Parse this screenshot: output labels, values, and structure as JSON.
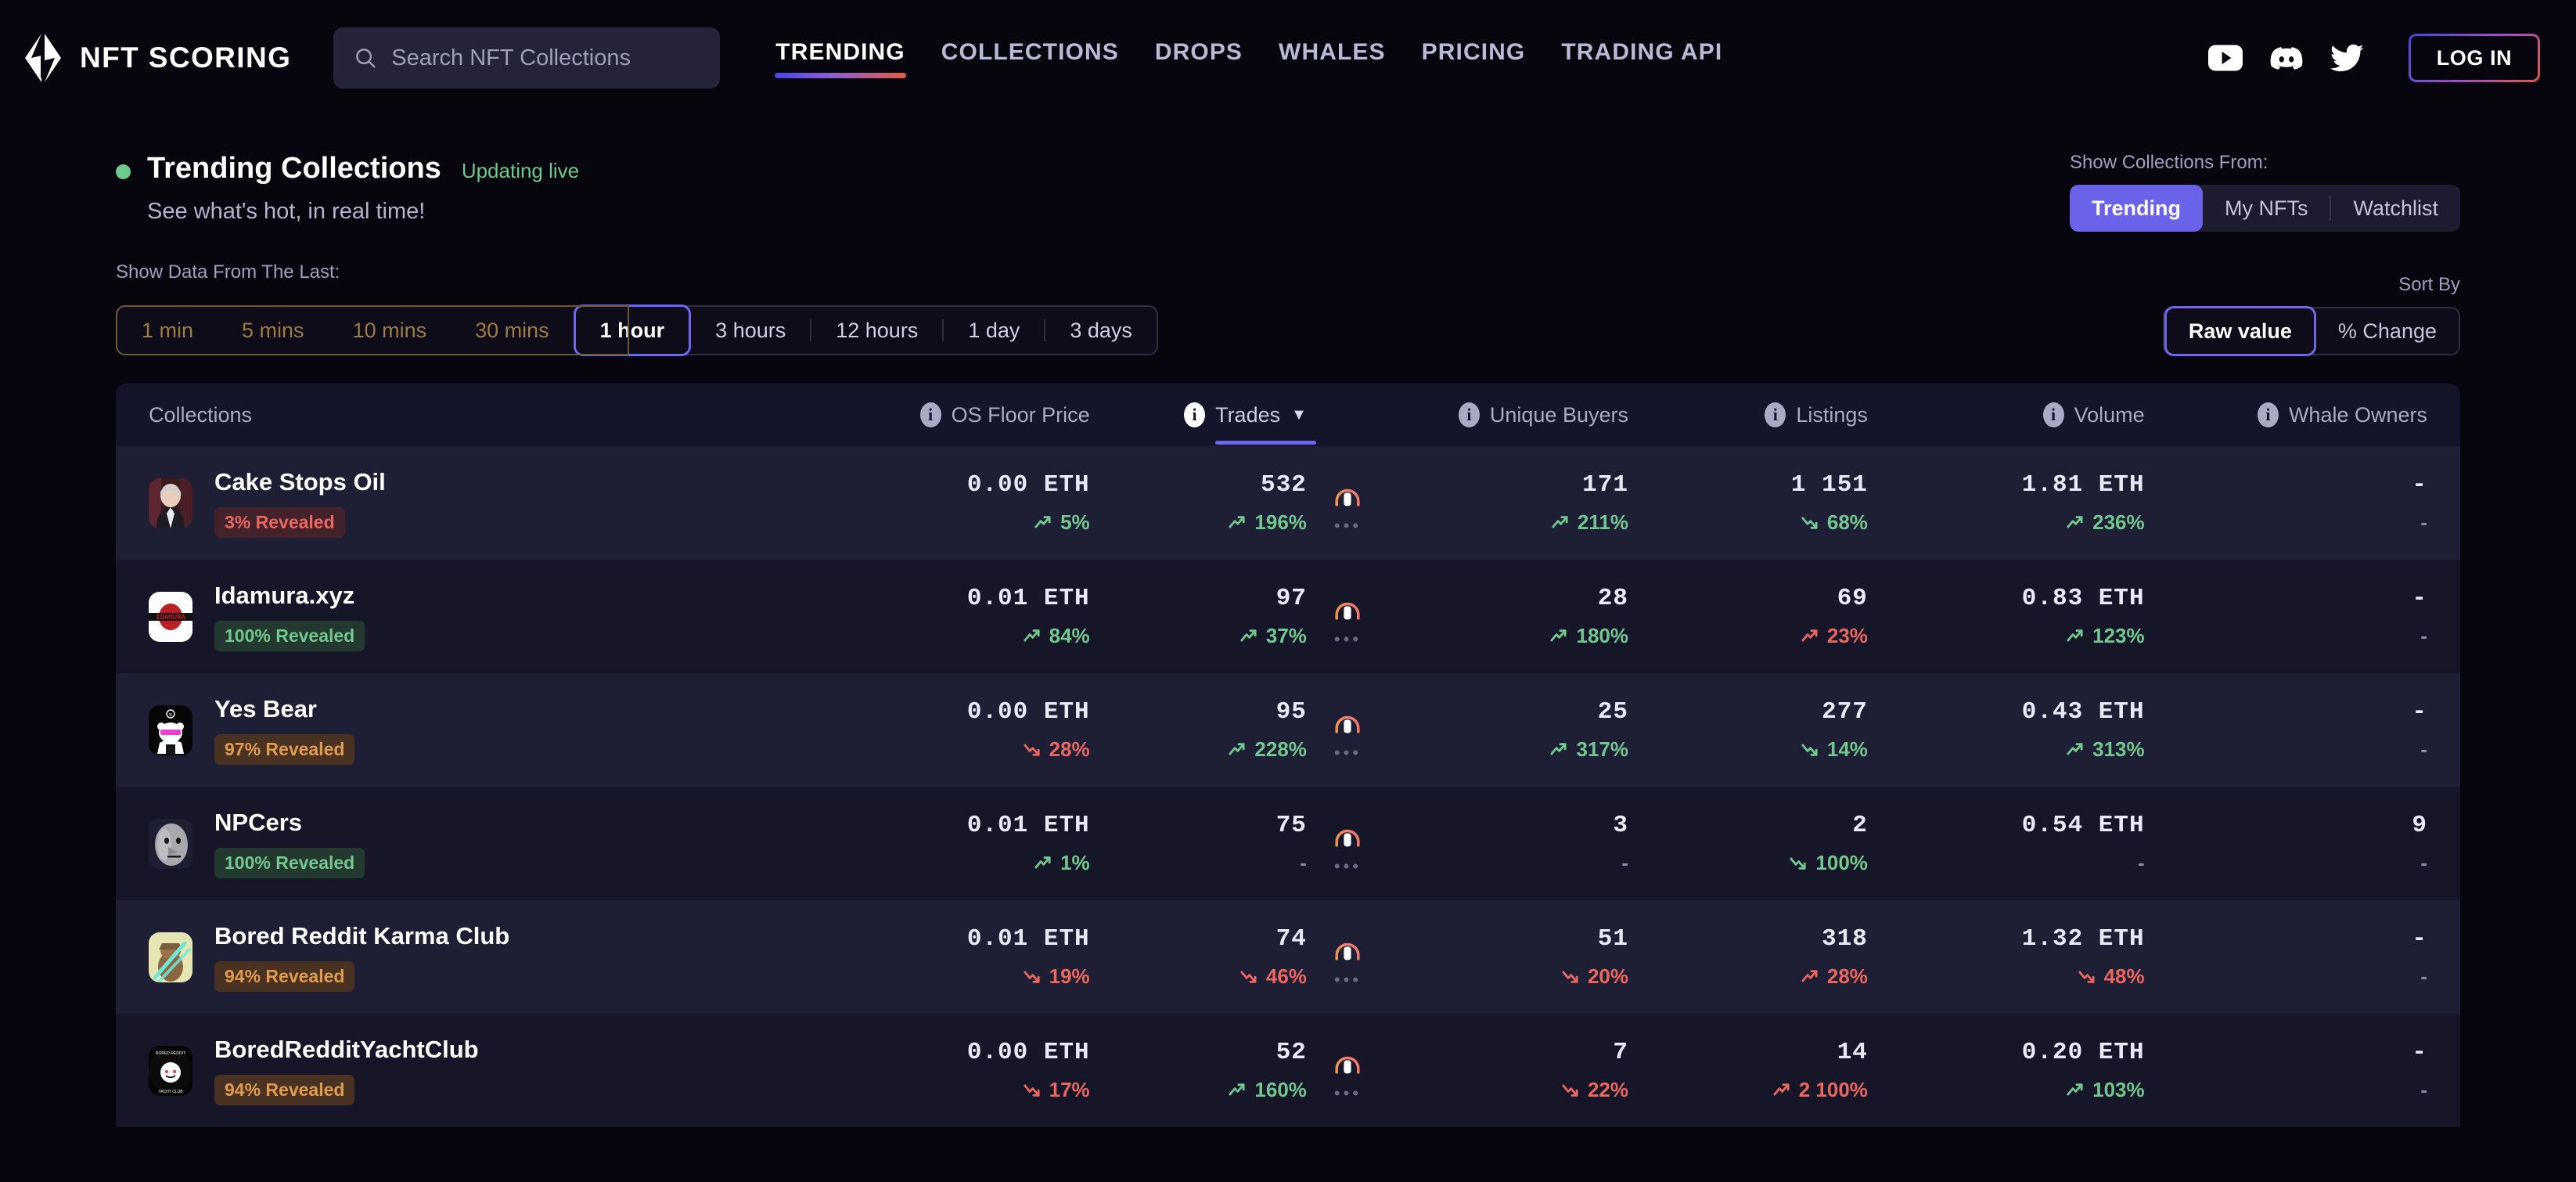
{
  "brand": {
    "name": "NFT SCORING",
    "logo_icon": "nft-scoring-logo"
  },
  "search": {
    "placeholder": "Search NFT Collections",
    "value": "",
    "icon": "search-icon"
  },
  "nav": {
    "items": [
      {
        "label": "TRENDING",
        "active": true
      },
      {
        "label": "COLLECTIONS",
        "active": false
      },
      {
        "label": "DROPS",
        "active": false
      },
      {
        "label": "WHALES",
        "active": false
      },
      {
        "label": "PRICING",
        "active": false
      },
      {
        "label": "TRADING API",
        "active": false
      }
    ],
    "socials": [
      "youtube-icon",
      "discord-icon",
      "twitter-icon"
    ],
    "login_label": "LOG IN"
  },
  "header": {
    "title": "Trending Collections",
    "live_label": "Updating live",
    "subtitle": "See what's hot, in real time!",
    "source_label": "Show Collections From:",
    "source_options": [
      {
        "label": "Trending",
        "selected": true
      },
      {
        "label": "My NFTs",
        "selected": false
      },
      {
        "label": "Watchlist",
        "selected": false
      }
    ],
    "timeframe_label": "Show Data From The Last:",
    "timeframes": [
      {
        "label": "1 min",
        "state": "locked"
      },
      {
        "label": "5 mins",
        "state": "locked"
      },
      {
        "label": "10 mins",
        "state": "locked"
      },
      {
        "label": "30 mins",
        "state": "locked"
      },
      {
        "label": "1 hour",
        "state": "selected"
      },
      {
        "label": "3 hours",
        "state": "normal"
      },
      {
        "label": "12 hours",
        "state": "normal"
      },
      {
        "label": "1 day",
        "state": "normal"
      },
      {
        "label": "3 days",
        "state": "normal"
      }
    ],
    "sort_label": "Sort By",
    "sort_options": [
      {
        "label": "Raw value",
        "selected": true
      },
      {
        "label": "% Change",
        "selected": false
      }
    ]
  },
  "table": {
    "columns": [
      {
        "key": "collections",
        "label": "Collections",
        "info": false,
        "active": false
      },
      {
        "key": "floor",
        "label": "OS Floor Price",
        "info": true,
        "active": false
      },
      {
        "key": "trades",
        "label": "Trades",
        "info": true,
        "active": true,
        "sort": "desc",
        "caret": "▼"
      },
      {
        "key": "buyers",
        "label": "Unique Buyers",
        "info": true,
        "active": false
      },
      {
        "key": "listings",
        "label": "Listings",
        "info": true,
        "active": false
      },
      {
        "key": "volume",
        "label": "Volume",
        "info": true,
        "active": false
      },
      {
        "key": "whales",
        "label": "Whale Owners",
        "info": true,
        "active": false
      }
    ],
    "rows": [
      {
        "name": "Cake Stops Oil",
        "avatar": "avatar-cake-stops-oil",
        "badge": {
          "text": "3% Revealed",
          "tone": "red"
        },
        "floor": {
          "value": "0.00  ETH",
          "delta": "5%",
          "dir": "up",
          "tone": "up"
        },
        "trades": {
          "value": "532",
          "delta": "196%",
          "dir": "up",
          "tone": "up"
        },
        "lock": "lock-icon",
        "buyers": {
          "value": "171",
          "delta": "211%",
          "dir": "up",
          "tone": "up"
        },
        "listings": {
          "value": "1 151",
          "delta": "68%",
          "dir": "down",
          "tone": "up"
        },
        "volume": {
          "value": "1.81 ETH",
          "delta": "236%",
          "dir": "up",
          "tone": "up"
        },
        "whales": {
          "value": "-",
          "delta": "-",
          "dir": "none",
          "tone": "muted"
        }
      },
      {
        "name": "Idamura.xyz",
        "avatar": "avatar-idamura",
        "badge": {
          "text": "100% Revealed",
          "tone": "green"
        },
        "floor": {
          "value": "0.01  ETH",
          "delta": "84%",
          "dir": "up",
          "tone": "up"
        },
        "trades": {
          "value": "97",
          "delta": "37%",
          "dir": "up",
          "tone": "up"
        },
        "lock": "lock-icon",
        "buyers": {
          "value": "28",
          "delta": "180%",
          "dir": "up",
          "tone": "up"
        },
        "listings": {
          "value": "69",
          "delta": "23%",
          "dir": "up",
          "tone": "down"
        },
        "volume": {
          "value": "0.83 ETH",
          "delta": "123%",
          "dir": "up",
          "tone": "up"
        },
        "whales": {
          "value": "-",
          "delta": "-",
          "dir": "none",
          "tone": "muted"
        }
      },
      {
        "name": "Yes Bear",
        "avatar": "avatar-yes-bear",
        "badge": {
          "text": "97% Revealed",
          "tone": "amber"
        },
        "floor": {
          "value": "0.00  ETH",
          "delta": "28%",
          "dir": "down",
          "tone": "down"
        },
        "trades": {
          "value": "95",
          "delta": "228%",
          "dir": "up",
          "tone": "up"
        },
        "lock": "lock-icon",
        "buyers": {
          "value": "25",
          "delta": "317%",
          "dir": "up",
          "tone": "up"
        },
        "listings": {
          "value": "277",
          "delta": "14%",
          "dir": "down",
          "tone": "up"
        },
        "volume": {
          "value": "0.43 ETH",
          "delta": "313%",
          "dir": "up",
          "tone": "up"
        },
        "whales": {
          "value": "-",
          "delta": "-",
          "dir": "none",
          "tone": "muted"
        }
      },
      {
        "name": "NPCers",
        "avatar": "avatar-npcers",
        "badge": {
          "text": "100% Revealed",
          "tone": "green"
        },
        "floor": {
          "value": "0.01  ETH",
          "delta": "1%",
          "dir": "up",
          "tone": "up"
        },
        "trades": {
          "value": "75",
          "delta": "-",
          "dir": "none",
          "tone": "muted"
        },
        "lock": "lock-icon",
        "buyers": {
          "value": "3",
          "delta": "-",
          "dir": "none",
          "tone": "muted"
        },
        "listings": {
          "value": "2",
          "delta": "100%",
          "dir": "down",
          "tone": "up"
        },
        "volume": {
          "value": "0.54 ETH",
          "delta": "-",
          "dir": "none",
          "tone": "muted"
        },
        "whales": {
          "value": "9",
          "delta": "-",
          "dir": "none",
          "tone": "muted"
        }
      },
      {
        "name": "Bored Reddit Karma Club",
        "avatar": "avatar-bored-reddit-karma-club",
        "badge": {
          "text": "94% Revealed",
          "tone": "amber"
        },
        "floor": {
          "value": "0.01  ETH",
          "delta": "19%",
          "dir": "down",
          "tone": "down"
        },
        "trades": {
          "value": "74",
          "delta": "46%",
          "dir": "down",
          "tone": "down"
        },
        "lock": "lock-icon",
        "buyers": {
          "value": "51",
          "delta": "20%",
          "dir": "down",
          "tone": "down"
        },
        "listings": {
          "value": "318",
          "delta": "28%",
          "dir": "up",
          "tone": "down"
        },
        "volume": {
          "value": "1.32 ETH",
          "delta": "48%",
          "dir": "down",
          "tone": "down"
        },
        "whales": {
          "value": "-",
          "delta": "-",
          "dir": "none",
          "tone": "muted"
        }
      },
      {
        "name": "BoredRedditYachtClub",
        "avatar": "avatar-bored-reddit-yacht-club",
        "badge": {
          "text": "94% Revealed",
          "tone": "amber"
        },
        "floor": {
          "value": "0.00  ETH",
          "delta": "17%",
          "dir": "down",
          "tone": "down"
        },
        "trades": {
          "value": "52",
          "delta": "160%",
          "dir": "up",
          "tone": "up"
        },
        "lock": "lock-icon",
        "buyers": {
          "value": "7",
          "delta": "22%",
          "dir": "down",
          "tone": "down"
        },
        "listings": {
          "value": "14",
          "delta": "2 100%",
          "dir": "up",
          "tone": "down"
        },
        "volume": {
          "value": "0.20 ETH",
          "delta": "103%",
          "dir": "up",
          "tone": "up"
        },
        "whales": {
          "value": "-",
          "delta": "-",
          "dir": "none",
          "tone": "muted"
        }
      }
    ]
  },
  "colors": {
    "accent": "#6f66ef",
    "up": "#72c78f",
    "down": "#e8675f",
    "page_bg": "#07060f",
    "row_odd": "#1e1e35",
    "row_even": "#161628"
  }
}
